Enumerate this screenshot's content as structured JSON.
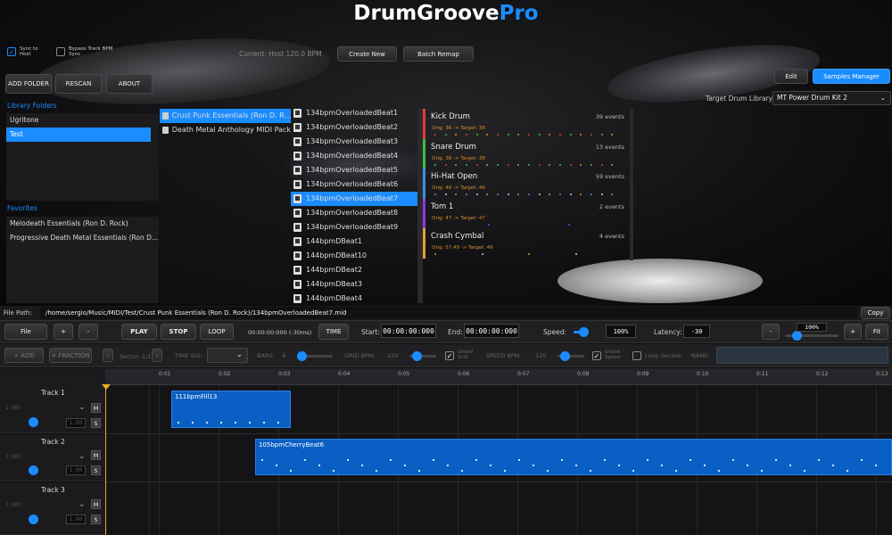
{
  "app": {
    "title_main": "DrumGroove",
    "title_accent": "Pro",
    "accent": "#1a8cff"
  },
  "top": {
    "sync_host": "Sync to Host",
    "bypass_bpm": "Bypass Track BPM Sync",
    "current": "Current: Host 120.0 BPM",
    "create_new": "Create New",
    "batch_remap": "Batch Remap",
    "edit": "Edit",
    "samples_manager": "Samples Manager",
    "target_label": "Target Drum Library:",
    "target_value": "MT Power Drum Kit 2"
  },
  "library": {
    "add_folder": "ADD FOLDER",
    "rescan": "RESCAN",
    "about": "ABOUT",
    "folders_title": "Library Folders",
    "folders": [
      "Ugritone",
      "Test"
    ],
    "favorites_title": "Favorites",
    "favorites": [
      "Melodeath Essentials (Ron D. Rock)",
      "Progressive Death Metal Essentials (Ron D...."
    ]
  },
  "packs": [
    "Crust Punk Essentials (Ron D. R...",
    "Death Metal Anthology MIDI Pack"
  ],
  "files": [
    "134bpmOverloadedBeat1",
    "134bpmOverloadedBeat2",
    "134bpmOverloadedBeat3",
    "134bpmOverloadedBeat4",
    "134bpmOverloadedBeat5",
    "134bpmOverloadedBeat6",
    "134bpmOverloadedBeat7",
    "134bpmOverloadedBeat8",
    "134bpmOverloadedBeat9",
    "144bpmDBeat1",
    "144bpmDBeat10",
    "144bpmDBeat2",
    "144bpmDBeat3",
    "144bpmDBeat4"
  ],
  "drums": [
    {
      "name": "Kick Drum",
      "events": "39 events",
      "map": "Orig: 36 -> Target: 36",
      "color": "#e03a3a"
    },
    {
      "name": "Snare Drum",
      "events": "13 events",
      "map": "Orig: 38 -> Target: 38",
      "color": "#3ac040"
    },
    {
      "name": "Hi-Hat Open",
      "events": "59 events",
      "map": "Orig: 46 -> Target: 46",
      "color": "#3a8fe0"
    },
    {
      "name": "Tom 1",
      "events": "2 events",
      "map": "Orig: 47 -> Target: 47",
      "color": "#8a3ae0"
    },
    {
      "name": "Crash Cymbal",
      "events": "4 events",
      "map": "Orig: 57,49 -> Target: 49",
      "color": "#e0a03a"
    }
  ],
  "path": {
    "label": "File Path:",
    "value": "/home/sergio/Music/MIDI/Test/Crust Punk Essentials (Ron D. Rock)/134bpmOverloadedBeat7.mid",
    "copy": "Copy"
  },
  "transport": {
    "file": "File",
    "plus": "+",
    "minus": "-",
    "play": "PLAY",
    "stop": "STOP",
    "loop": "LOOP",
    "time_readout": "00:00:00:000 (-30ms)",
    "time": "TIME",
    "start_label": "Start:",
    "start": "00:00:00:000",
    "end_label": "End:",
    "end": "00:00:00:000",
    "speed_label": "Speed:",
    "speed": "100%",
    "latency_label": "Latency:",
    "latency": "-30",
    "zoom": "100%",
    "fit": "Fit"
  },
  "toolbar2": {
    "add": "+ ADD",
    "fraction": "+ FRACTION",
    "sector": "Sector: 1/1",
    "time_sig": "TIME SIG:",
    "bars_label": "BARS:",
    "bars": "4",
    "grid_bpm_label": "GRID BPM:",
    "grid_bpm": "120",
    "global_grid": "Global Grid",
    "speed_bpm_label": "SPEED BPM",
    "speed_bpm": "120",
    "global_speed": "Global Speed",
    "loop_section": "Loop Section",
    "name": "NAME:"
  },
  "ruler": [
    "0:01",
    "0:02",
    "0:03",
    "0:04",
    "0:05",
    "0:06",
    "0:07",
    "0:08",
    "0:09",
    "0:10",
    "0:11",
    "0:12",
    "0:13"
  ],
  "tracks": [
    {
      "name": "Track 1",
      "m": "M",
      "s": "S",
      "ch": "1 (All)",
      "vol": "1.00",
      "clip": "111bpmFill13"
    },
    {
      "name": "Track 2",
      "m": "M",
      "s": "S",
      "ch": "1 (All)",
      "vol": "1.00",
      "clip": "105bpmCherryBeat6"
    },
    {
      "name": "Track 3",
      "m": "M",
      "s": "S",
      "ch": "1 (All)",
      "vol": "1.00"
    }
  ]
}
